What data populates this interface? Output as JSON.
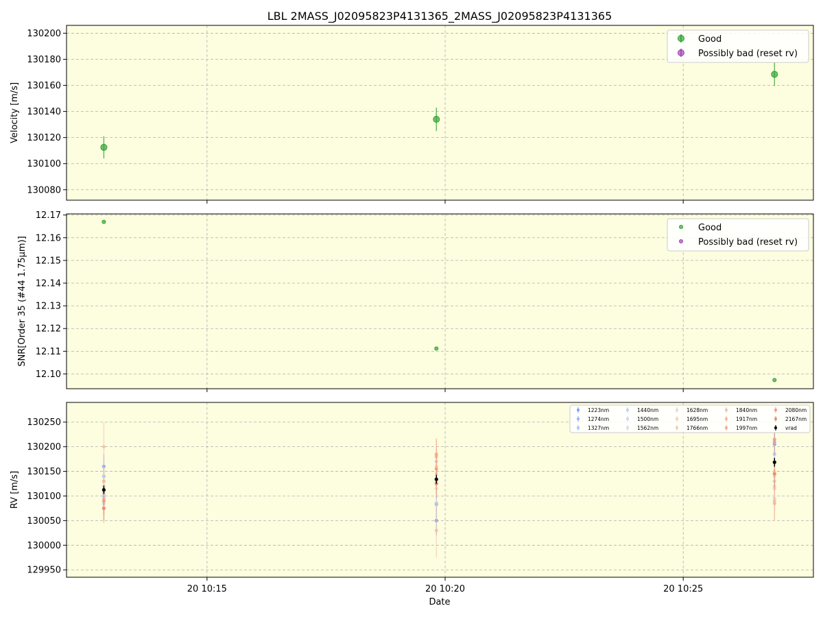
{
  "title": "LBL 2MASS_J02095823P4131365_2MASS_J02095823P4131365",
  "xlabel": "Date",
  "x_ticks": [
    "20 10:15",
    "20 10:20",
    "20 10:25"
  ],
  "x_tick_times": [
    "10:15:00",
    "10:20:00",
    "10:25:00"
  ],
  "x_range": [
    "10:12:03",
    "10:27:44"
  ],
  "colors": {
    "good": "#2ca02c",
    "bad": "#9d3fb2",
    "background": "#fdfde0",
    "vrad": "#000000"
  },
  "chart_data": [
    {
      "type": "scatter",
      "ylabel": "Velocity [m/s]",
      "ylim": [
        130072,
        130206
      ],
      "y_ticks": [
        130080,
        130100,
        130120,
        130140,
        130160,
        130180,
        130200
      ],
      "grid": true,
      "legend": {
        "placement": "top-right",
        "entries": [
          "Good",
          "Possibly bad (reset rv)"
        ]
      },
      "series": [
        {
          "name": "Good",
          "points": [
            {
              "t": "10:12:50",
              "y": 130112.5,
              "err": 8.5
            },
            {
              "t": "10:19:49",
              "y": 130134,
              "err": 9
            },
            {
              "t": "10:26:55",
              "y": 130168.5,
              "err": 9
            }
          ]
        },
        {
          "name": "Possibly bad (reset rv)",
          "points": []
        }
      ]
    },
    {
      "type": "scatter",
      "ylabel": "SNR[Order 35 (#44 1.75μm)]",
      "ylim": [
        12.0935,
        12.1705
      ],
      "y_ticks": [
        12.1,
        12.11,
        12.12,
        12.13,
        12.14,
        12.15,
        12.16,
        12.17
      ],
      "grid": true,
      "legend": {
        "placement": "top-right",
        "entries": [
          "Good",
          "Possibly bad (reset rv)"
        ]
      },
      "series": [
        {
          "name": "Good",
          "points": [
            {
              "t": "10:12:50",
              "y": 12.167
            },
            {
              "t": "10:19:49",
              "y": 12.1112
            },
            {
              "t": "10:26:55",
              "y": 12.0973
            }
          ]
        },
        {
          "name": "Possibly bad (reset rv)",
          "points": []
        }
      ]
    },
    {
      "type": "scatter",
      "ylabel": "RV [m/s]",
      "ylim": [
        129935,
        130290
      ],
      "y_ticks": [
        129950,
        130000,
        130050,
        130100,
        130150,
        130200,
        130250
      ],
      "grid": true,
      "legend": {
        "placement": "top-right",
        "columns": 5
      },
      "times": [
        "10:12:50",
        "10:19:49",
        "10:26:55"
      ],
      "series": [
        {
          "name": "1223nm",
          "color": "#7b9ff9",
          "values": [
            130160,
            130050,
            130205
          ],
          "errors": [
            25,
            30,
            25
          ]
        },
        {
          "name": "1274nm",
          "color": "#90b2fe",
          "values": [
            130095,
            130083,
            130210
          ],
          "errors": [
            22,
            28,
            24
          ]
        },
        {
          "name": "1327nm",
          "color": "#a5c3fe",
          "values": [
            130140,
            130085,
            130185
          ],
          "errors": [
            20,
            25,
            22
          ]
        },
        {
          "name": "1440nm",
          "color": "#b9d0f9",
          "values": [
            130100,
            130170,
            130130
          ],
          "errors": [
            25,
            30,
            28
          ]
        },
        {
          "name": "1500nm",
          "color": "#c9d7f0",
          "values": [
            130085,
            130125,
            130095
          ],
          "errors": [
            22,
            30,
            26
          ]
        },
        {
          "name": "1562nm",
          "color": "#d7dce3",
          "values": [
            130105,
            130145,
            130120
          ],
          "errors": [
            25,
            30,
            28
          ]
        },
        {
          "name": "1628nm",
          "color": "#e3d9d3",
          "values": [
            130120,
            130115,
            130140
          ],
          "errors": [
            28,
            32,
            30
          ]
        },
        {
          "name": "1695nm",
          "color": "#ecd3c5",
          "values": [
            130095,
            130160,
            130150
          ],
          "errors": [
            30,
            35,
            32
          ]
        },
        {
          "name": "1766nm",
          "color": "#f2cbb7",
          "values": [
            130110,
            130130,
            130115
          ],
          "errors": [
            30,
            35,
            30
          ]
        },
        {
          "name": "1840nm",
          "color": "#f5c0a7",
          "values": [
            130200,
            130030,
            130090
          ],
          "errors": [
            50,
            55,
            40
          ]
        },
        {
          "name": "1917nm",
          "color": "#f6b599",
          "values": [
            130130,
            130180,
            130085
          ],
          "errors": [
            30,
            35,
            35
          ]
        },
        {
          "name": "1997nm",
          "color": "#f4a889",
          "values": [
            130075,
            130185,
            130145
          ],
          "errors": [
            30,
            32,
            30
          ]
        },
        {
          "name": "2080nm",
          "color": "#f29b7b",
          "values": [
            130090,
            130155,
            130215
          ],
          "errors": [
            28,
            30,
            28
          ]
        },
        {
          "name": "2167nm",
          "color": "#eb8c6c",
          "values": [
            130075,
            130125,
            130145
          ],
          "errors": [
            25,
            30,
            28
          ]
        },
        {
          "name": "vrad",
          "color": "#000000",
          "values": [
            130112.5,
            130134,
            130168.5
          ],
          "errors": [
            8.5,
            9,
            9
          ]
        }
      ]
    }
  ]
}
